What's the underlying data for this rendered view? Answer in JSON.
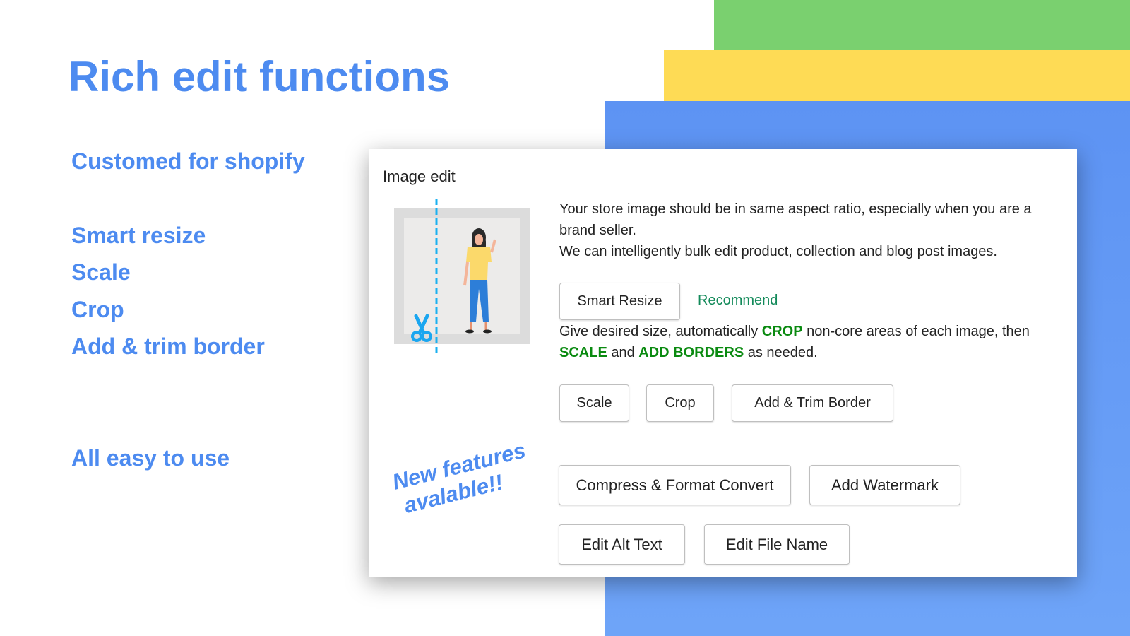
{
  "colors": {
    "accent": "#4d8bf0",
    "green_band": "#7ad06f",
    "yellow_band": "#fedb55",
    "blue_band": "#6199f5",
    "highlight": "#0a8a10"
  },
  "headline": "Rich edit functions",
  "features": {
    "customed": "Customed for shopify",
    "items": [
      "Smart resize",
      "Scale",
      "Crop",
      "Add & trim border"
    ],
    "easy": "All easy to use"
  },
  "card": {
    "title": "Image edit",
    "intro_line1": "Your store image should be in same aspect ratio, especially when you are a",
    "intro_line2": "brand seller.",
    "intro_line3": "We can intelligently bulk edit product, collection and blog post images.",
    "smart_resize": "Smart Resize",
    "recommend": "Recommend",
    "desc": {
      "p1": "Give desired size, automatically ",
      "crop": "CROP",
      "p2": " non-core areas of each image, then",
      "scale": "SCALE",
      "p3": " and ",
      "borders": "ADD BORDERS",
      "p4": " as needed."
    },
    "buttons": {
      "scale": "Scale",
      "crop": "Crop",
      "border": "Add & Trim Border",
      "compress": "Compress & Format Convert",
      "watermark": "Add Watermark",
      "alt": "Edit Alt Text",
      "filename": "Edit File Name"
    },
    "new_features_line1": "New features",
    "new_features_line2": "avalable!!",
    "image_icon": "person-crop-illustration",
    "scissors_icon": "scissors-icon"
  }
}
